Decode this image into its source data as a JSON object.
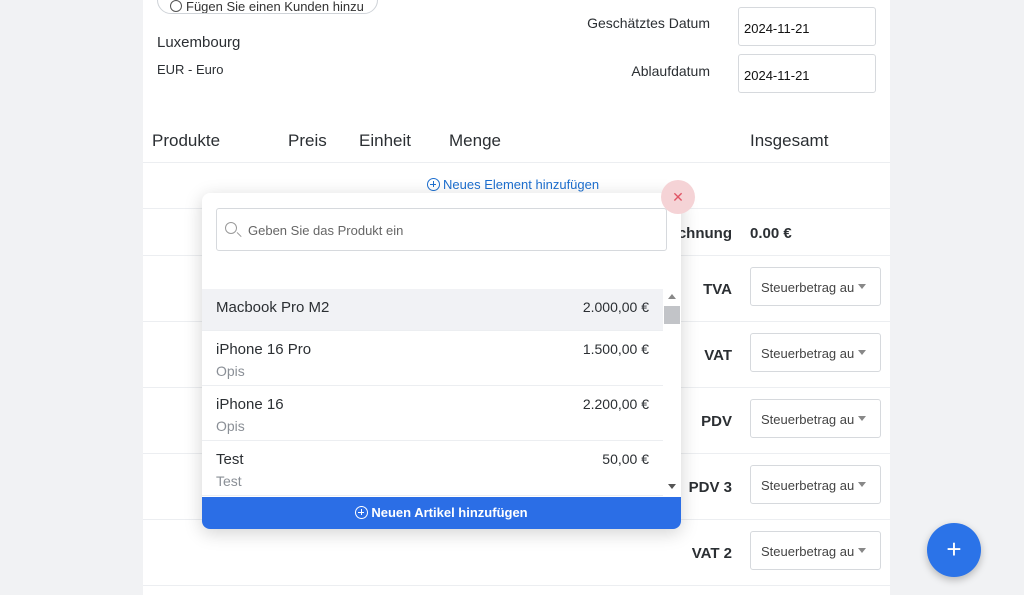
{
  "client": {
    "add_client_label": "Fügen Sie einen Kunden hinzu",
    "country": "Luxembourg",
    "currency": "EUR - Euro"
  },
  "dates": {
    "estimated_label": "Geschätztes Datum",
    "estimated_value": "2024-11-21",
    "expiry_label": "Ablaufdatum",
    "expiry_value": "2024-11-21"
  },
  "table": {
    "headers": [
      "Produkte",
      "Preis",
      "Einheit",
      "Menge",
      "Insgesamt"
    ],
    "add_element_label": "Neues Element hinzufügen"
  },
  "summary": {
    "subtotal_label_partial": "chnung",
    "subtotal_value": "0.00 €",
    "tax_rows": [
      {
        "label": "TVA",
        "select_value": "Steuerbetrag au"
      },
      {
        "label": "VAT",
        "select_value": "Steuerbetrag au"
      },
      {
        "label": "PDV",
        "select_value": "Steuerbetrag au"
      },
      {
        "label": "PDV 3",
        "select_value": "Steuerbetrag au"
      },
      {
        "label": "VAT 2",
        "select_value": "Steuerbetrag au"
      }
    ]
  },
  "product_popup": {
    "search_placeholder": "Geben Sie das Produkt ein",
    "items": [
      {
        "name": "Macbook Pro M2",
        "price": "2.000,00 €",
        "desc": ""
      },
      {
        "name": "iPhone 16 Pro",
        "price": "1.500,00 €",
        "desc": "Opis"
      },
      {
        "name": "iPhone 16",
        "price": "2.200,00 €",
        "desc": "Opis"
      },
      {
        "name": "Test",
        "price": "50,00 €",
        "desc": "Test"
      }
    ],
    "add_item_label": "Neuen Artikel hinzufügen",
    "close_symbol": "✕"
  },
  "fab": {
    "symbol": "+"
  },
  "colors": {
    "accent": "#2b6ee6",
    "link": "#1d6fcf",
    "close_bg": "#f5d3d6",
    "close_fg": "#e05565"
  }
}
